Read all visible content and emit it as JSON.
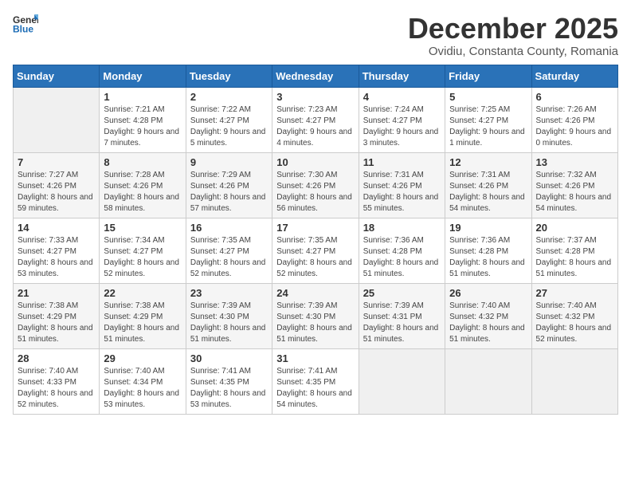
{
  "header": {
    "logo_general": "General",
    "logo_blue": "Blue",
    "month_title": "December 2025",
    "location": "Ovidiu, Constanta County, Romania"
  },
  "weekdays": [
    "Sunday",
    "Monday",
    "Tuesday",
    "Wednesday",
    "Thursday",
    "Friday",
    "Saturday"
  ],
  "weeks": [
    [
      {
        "day": null
      },
      {
        "day": "1",
        "sunrise": "Sunrise: 7:21 AM",
        "sunset": "Sunset: 4:28 PM",
        "daylight": "Daylight: 9 hours and 7 minutes."
      },
      {
        "day": "2",
        "sunrise": "Sunrise: 7:22 AM",
        "sunset": "Sunset: 4:27 PM",
        "daylight": "Daylight: 9 hours and 5 minutes."
      },
      {
        "day": "3",
        "sunrise": "Sunrise: 7:23 AM",
        "sunset": "Sunset: 4:27 PM",
        "daylight": "Daylight: 9 hours and 4 minutes."
      },
      {
        "day": "4",
        "sunrise": "Sunrise: 7:24 AM",
        "sunset": "Sunset: 4:27 PM",
        "daylight": "Daylight: 9 hours and 3 minutes."
      },
      {
        "day": "5",
        "sunrise": "Sunrise: 7:25 AM",
        "sunset": "Sunset: 4:27 PM",
        "daylight": "Daylight: 9 hours and 1 minute."
      },
      {
        "day": "6",
        "sunrise": "Sunrise: 7:26 AM",
        "sunset": "Sunset: 4:26 PM",
        "daylight": "Daylight: 9 hours and 0 minutes."
      }
    ],
    [
      {
        "day": "7",
        "sunrise": "Sunrise: 7:27 AM",
        "sunset": "Sunset: 4:26 PM",
        "daylight": "Daylight: 8 hours and 59 minutes."
      },
      {
        "day": "8",
        "sunrise": "Sunrise: 7:28 AM",
        "sunset": "Sunset: 4:26 PM",
        "daylight": "Daylight: 8 hours and 58 minutes."
      },
      {
        "day": "9",
        "sunrise": "Sunrise: 7:29 AM",
        "sunset": "Sunset: 4:26 PM",
        "daylight": "Daylight: 8 hours and 57 minutes."
      },
      {
        "day": "10",
        "sunrise": "Sunrise: 7:30 AM",
        "sunset": "Sunset: 4:26 PM",
        "daylight": "Daylight: 8 hours and 56 minutes."
      },
      {
        "day": "11",
        "sunrise": "Sunrise: 7:31 AM",
        "sunset": "Sunset: 4:26 PM",
        "daylight": "Daylight: 8 hours and 55 minutes."
      },
      {
        "day": "12",
        "sunrise": "Sunrise: 7:31 AM",
        "sunset": "Sunset: 4:26 PM",
        "daylight": "Daylight: 8 hours and 54 minutes."
      },
      {
        "day": "13",
        "sunrise": "Sunrise: 7:32 AM",
        "sunset": "Sunset: 4:26 PM",
        "daylight": "Daylight: 8 hours and 54 minutes."
      }
    ],
    [
      {
        "day": "14",
        "sunrise": "Sunrise: 7:33 AM",
        "sunset": "Sunset: 4:27 PM",
        "daylight": "Daylight: 8 hours and 53 minutes."
      },
      {
        "day": "15",
        "sunrise": "Sunrise: 7:34 AM",
        "sunset": "Sunset: 4:27 PM",
        "daylight": "Daylight: 8 hours and 52 minutes."
      },
      {
        "day": "16",
        "sunrise": "Sunrise: 7:35 AM",
        "sunset": "Sunset: 4:27 PM",
        "daylight": "Daylight: 8 hours and 52 minutes."
      },
      {
        "day": "17",
        "sunrise": "Sunrise: 7:35 AM",
        "sunset": "Sunset: 4:27 PM",
        "daylight": "Daylight: 8 hours and 52 minutes."
      },
      {
        "day": "18",
        "sunrise": "Sunrise: 7:36 AM",
        "sunset": "Sunset: 4:28 PM",
        "daylight": "Daylight: 8 hours and 51 minutes."
      },
      {
        "day": "19",
        "sunrise": "Sunrise: 7:36 AM",
        "sunset": "Sunset: 4:28 PM",
        "daylight": "Daylight: 8 hours and 51 minutes."
      },
      {
        "day": "20",
        "sunrise": "Sunrise: 7:37 AM",
        "sunset": "Sunset: 4:28 PM",
        "daylight": "Daylight: 8 hours and 51 minutes."
      }
    ],
    [
      {
        "day": "21",
        "sunrise": "Sunrise: 7:38 AM",
        "sunset": "Sunset: 4:29 PM",
        "daylight": "Daylight: 8 hours and 51 minutes."
      },
      {
        "day": "22",
        "sunrise": "Sunrise: 7:38 AM",
        "sunset": "Sunset: 4:29 PM",
        "daylight": "Daylight: 8 hours and 51 minutes."
      },
      {
        "day": "23",
        "sunrise": "Sunrise: 7:39 AM",
        "sunset": "Sunset: 4:30 PM",
        "daylight": "Daylight: 8 hours and 51 minutes."
      },
      {
        "day": "24",
        "sunrise": "Sunrise: 7:39 AM",
        "sunset": "Sunset: 4:30 PM",
        "daylight": "Daylight: 8 hours and 51 minutes."
      },
      {
        "day": "25",
        "sunrise": "Sunrise: 7:39 AM",
        "sunset": "Sunset: 4:31 PM",
        "daylight": "Daylight: 8 hours and 51 minutes."
      },
      {
        "day": "26",
        "sunrise": "Sunrise: 7:40 AM",
        "sunset": "Sunset: 4:32 PM",
        "daylight": "Daylight: 8 hours and 51 minutes."
      },
      {
        "day": "27",
        "sunrise": "Sunrise: 7:40 AM",
        "sunset": "Sunset: 4:32 PM",
        "daylight": "Daylight: 8 hours and 52 minutes."
      }
    ],
    [
      {
        "day": "28",
        "sunrise": "Sunrise: 7:40 AM",
        "sunset": "Sunset: 4:33 PM",
        "daylight": "Daylight: 8 hours and 52 minutes."
      },
      {
        "day": "29",
        "sunrise": "Sunrise: 7:40 AM",
        "sunset": "Sunset: 4:34 PM",
        "daylight": "Daylight: 8 hours and 53 minutes."
      },
      {
        "day": "30",
        "sunrise": "Sunrise: 7:41 AM",
        "sunset": "Sunset: 4:35 PM",
        "daylight": "Daylight: 8 hours and 53 minutes."
      },
      {
        "day": "31",
        "sunrise": "Sunrise: 7:41 AM",
        "sunset": "Sunset: 4:35 PM",
        "daylight": "Daylight: 8 hours and 54 minutes."
      },
      {
        "day": null
      },
      {
        "day": null
      },
      {
        "day": null
      }
    ]
  ]
}
